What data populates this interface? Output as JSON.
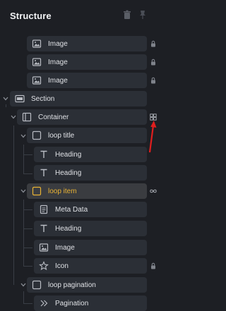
{
  "panel": {
    "title": "Structure",
    "icons": {
      "trash": "trash-icon",
      "pin": "pin-icon"
    }
  },
  "tree": [
    {
      "label": "Image",
      "icon": "image-icon",
      "right": "lock-icon"
    },
    {
      "label": "Image",
      "icon": "image-icon",
      "right": "lock-icon"
    },
    {
      "label": "Image",
      "icon": "image-icon",
      "right": "lock-icon"
    },
    {
      "label": "Section",
      "icon": "section-icon",
      "expanded": true
    },
    {
      "label": "Container",
      "icon": "container-icon",
      "expanded": true,
      "right": "grid-icon"
    },
    {
      "label": "loop title",
      "icon": "block-icon",
      "expanded": true
    },
    {
      "label": "Heading",
      "icon": "text-icon"
    },
    {
      "label": "Heading",
      "icon": "text-icon"
    },
    {
      "label": "loop item",
      "icon": "block-icon",
      "expanded": true,
      "active": true,
      "right": "infinity-icon"
    },
    {
      "label": "Meta Data",
      "icon": "meta-icon"
    },
    {
      "label": "Heading",
      "icon": "text-icon"
    },
    {
      "label": "Image",
      "icon": "image-icon"
    },
    {
      "label": "Icon",
      "icon": "star-icon",
      "right": "lock-icon"
    },
    {
      "label": "loop pagination",
      "icon": "block-icon",
      "expanded": true
    },
    {
      "label": "Pagination",
      "icon": "pagination-icon"
    }
  ],
  "colors": {
    "background": "#1d1f24",
    "row": "#2b2f36",
    "active_row": "#3a3c40",
    "active_label": "#e8b234",
    "annotation_arrow": "#e01e1e"
  }
}
